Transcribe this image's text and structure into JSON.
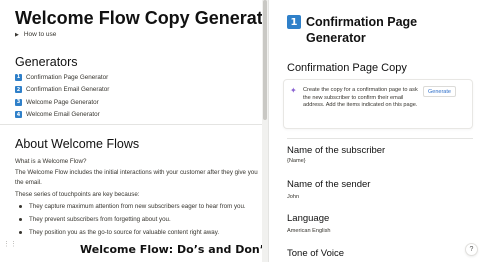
{
  "doc": {
    "title": "Welcome Flow Copy Generator",
    "how_to_use": "How to use"
  },
  "generators": {
    "heading": "Generators",
    "items": [
      {
        "num": "1",
        "label": "Confirmation Page Generator"
      },
      {
        "num": "2",
        "label": "Confirmation Email Generator"
      },
      {
        "num": "3",
        "label": "Welcome Page Generator"
      },
      {
        "num": "4",
        "label": "Welcome Email Generator"
      }
    ]
  },
  "about": {
    "heading": "About Welcome Flows",
    "question": "What is a Welcome Flow?",
    "intro": "The Welcome Flow includes the initial interactions with your customer after they give you the email.",
    "touchpoints": "These series of touchpoints are key because:",
    "bullets": [
      "They capture maximum attention from new subscribers eager to hear from you.",
      "They prevent subscribers from forgetting about you.",
      "They position you as the go-to source for valuable content right away."
    ],
    "next_heading": "Welcome Flow: Do’s and Don’ts"
  },
  "panel": {
    "num": "1",
    "title": "Confirmation Page Generator",
    "subtitle": "Confirmation Page Copy",
    "description": "Create the copy for a confirmation page to ask the new subscriber to confirm their email address. Add the items indicated on this page.",
    "generate_label": "Generate",
    "fields": [
      {
        "label": "Name of the subscriber",
        "value": "{Name}"
      },
      {
        "label": "Name of the sender",
        "value": "John"
      },
      {
        "label": "Language",
        "value": "American English"
      },
      {
        "label": "Tone of Voice",
        "value": ""
      }
    ],
    "help_label": "?"
  },
  "colors": {
    "accent": "#2f80c9",
    "ai_spark": "#8a63d2"
  }
}
